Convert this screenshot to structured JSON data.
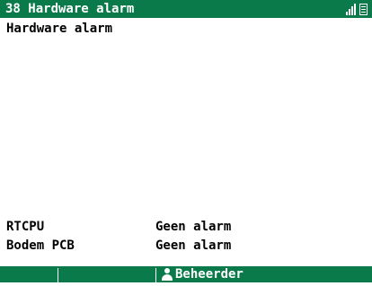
{
  "header": {
    "title": "38 Hardware alarm",
    "icons": [
      "signal-strength-icon",
      "document-icon"
    ]
  },
  "main": {
    "heading": "Hardware alarm",
    "rows": [
      {
        "label": "RTCPU",
        "value": "Geen alarm"
      },
      {
        "label": "Bodem PCB",
        "value": "Geen alarm"
      }
    ]
  },
  "softkeys": [
    {
      "label": ""
    },
    {
      "label": ""
    },
    {
      "label": "Beheerder",
      "icon": "user-icon"
    },
    {
      "label": ""
    }
  ],
  "colors": {
    "bar": "#0b7a4a",
    "background": "#ffffff",
    "text": "#000000"
  }
}
